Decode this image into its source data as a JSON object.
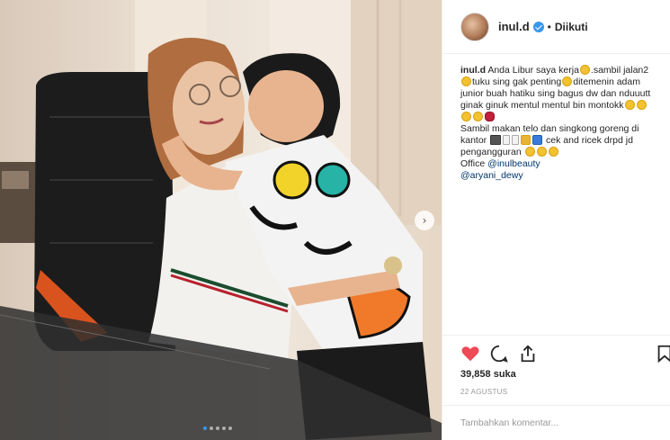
{
  "post": {
    "username": "inul.d",
    "separator": "•",
    "follow_status": "Diikuti",
    "caption": {
      "username": "inul.d",
      "line1": "Anda Libur saya kerja",
      "line1b": ".sambil jalan2",
      "line2": "tuku sing gak penting",
      "line2b": "ditemenin adam",
      "line3": "junior buah hatiku sing bagus dw dan nduuutt",
      "line4": "ginak ginuk mentul mentul bin montokk",
      "line6": "Sambil makan telo dan singkong goreng di",
      "line7a": "kantor",
      "line7b": "cek and ricek drpd jd",
      "line8": "pengangguran",
      "line9a": "Office ",
      "mention1": "@inulbeauty",
      "mention2": "@aryani_dewy"
    },
    "likes": "39,858 suka",
    "date": "22 AGUSTUS",
    "comment_placeholder": "Tambahkan komentar...",
    "carousel_pages": 5,
    "carousel_active": 1
  },
  "icons": {
    "like": "heart-icon",
    "comment": "comment-icon",
    "share": "share-icon",
    "save": "bookmark-icon",
    "verified": "verified-badge-icon",
    "next": "chevron-right-icon"
  },
  "colors": {
    "heart": "#ed4956",
    "link": "#003569",
    "verified": "#3897f0"
  }
}
